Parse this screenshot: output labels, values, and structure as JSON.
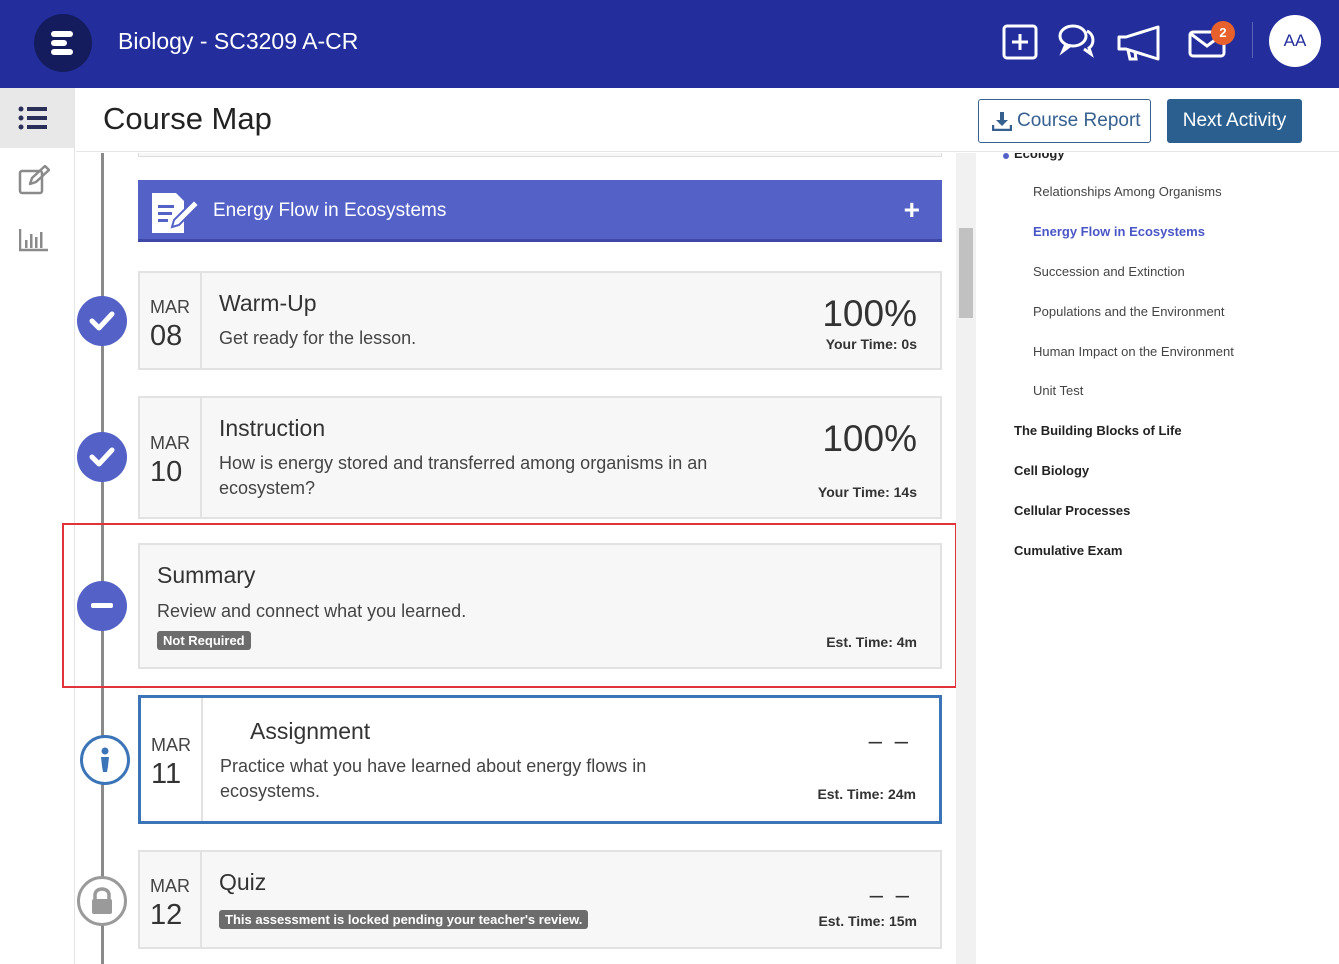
{
  "topbar": {
    "course_title": "Biology - SC3209 A-CR",
    "mail_badge_count": "2",
    "avatar_initials": "AA",
    "background_color": "#232e9c"
  },
  "header": {
    "page_title": "Course Map",
    "course_report_label": "Course Report",
    "next_activity_label": "Next Activity"
  },
  "lesson": {
    "title": "Energy Flow in Ecosystems",
    "expand_symbol": "+",
    "accent_color": "#5462c8"
  },
  "activities": [
    {
      "month": "MAR",
      "day": "08",
      "title": "Warm-Up",
      "description": "Get ready for the lesson.",
      "score": "100%",
      "time": "Your Time: 0s",
      "status": "complete"
    },
    {
      "month": "MAR",
      "day": "10",
      "title": "Instruction",
      "description": "How is energy stored and transferred among organisms in an ecosystem?",
      "score": "100%",
      "time": "Your Time: 14s",
      "status": "complete"
    },
    {
      "month": "",
      "day": "",
      "title": "Summary",
      "description": "Review and connect what you learned.",
      "badge": "Not Required",
      "time": "Est. Time: 4m",
      "status": "not-required"
    },
    {
      "month": "MAR",
      "day": "11",
      "title": "Assignment",
      "description": "Practice what you have learned about energy flows in ecosystems.",
      "score": "– –",
      "time": "Est. Time: 24m",
      "status": "current"
    },
    {
      "month": "MAR",
      "day": "12",
      "title": "Quiz",
      "badge": "This assessment is locked pending your teacher's review.",
      "score": "– –",
      "time": "Est. Time: 15m",
      "status": "locked"
    }
  ],
  "rightnav": {
    "partial_unit": "Ecology",
    "lessons": [
      {
        "label": "Relationships Among Organisms",
        "active": false
      },
      {
        "label": "Energy Flow in Ecosystems",
        "active": true
      },
      {
        "label": "Succession and Extinction",
        "active": false
      },
      {
        "label": "Populations and the Environment",
        "active": false
      },
      {
        "label": "Human Impact on the Environment",
        "active": false
      },
      {
        "label": "Unit Test",
        "active": false
      }
    ],
    "units": [
      "The Building Blocks of Life",
      "Cell Biology",
      "Cellular Processes",
      "Cumulative Exam"
    ]
  },
  "icons": {
    "rail": [
      "list-icon",
      "edit-icon",
      "bar-chart-icon"
    ],
    "topbar": [
      "add-box-icon",
      "chat-icon",
      "megaphone-icon",
      "mail-icon"
    ]
  }
}
